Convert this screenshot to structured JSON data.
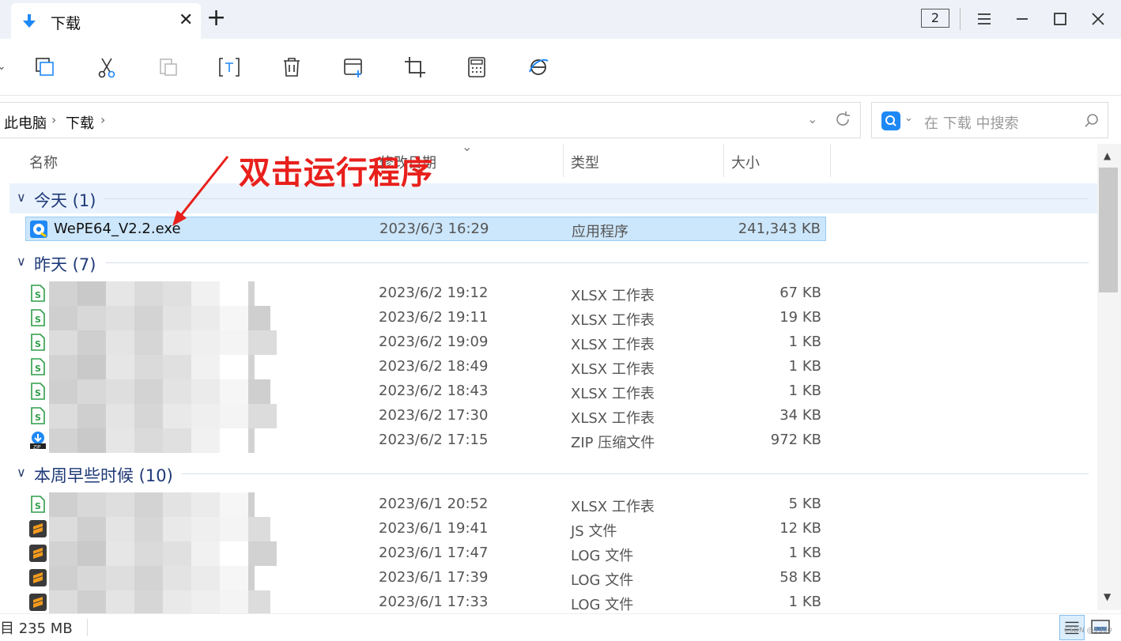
{
  "tab": {
    "title": "下载",
    "close": "✕",
    "new": "+"
  },
  "window": {
    "count": "2"
  },
  "toolbar": {
    "items": [
      "copy-icon",
      "cut-icon",
      "paste-icon",
      "rename-icon",
      "delete-icon",
      "new-folder-icon",
      "crop-icon",
      "calculator-icon",
      "browser-icon"
    ]
  },
  "address": {
    "crumbs": [
      "此电脑",
      "下载"
    ],
    "sep": "›",
    "dropdown": "⌄"
  },
  "search": {
    "placeholder": "在 下载 中搜索",
    "caret": "⌄"
  },
  "columns": {
    "name": "名称",
    "modified": "修改日期",
    "type": "类型",
    "size": "大小"
  },
  "annotation": {
    "text": "双击运行程序",
    "color": "#e8201c"
  },
  "groups": [
    {
      "label": "今天 (1)",
      "rows": [
        {
          "name": "WePE64_V2.2.exe",
          "date": "2023/6/3 16:29",
          "type": "应用程序",
          "size": "241,343 KB",
          "icon": "exe-icon",
          "selected": true
        }
      ]
    },
    {
      "label": "昨天 (7)",
      "rows": [
        {
          "name": "",
          "date": "2023/6/2 19:12",
          "type": "XLSX 工作表",
          "size": "67 KB",
          "icon": "xlsx-icon"
        },
        {
          "name": "",
          "date": "2023/6/2 19:11",
          "type": "XLSX 工作表",
          "size": "19 KB",
          "icon": "xlsx-icon"
        },
        {
          "name": "",
          "date": "2023/6/2 19:09",
          "type": "XLSX 工作表",
          "size": "1 KB",
          "icon": "xlsx-icon"
        },
        {
          "name": "",
          "date": "2023/6/2 18:49",
          "type": "XLSX 工作表",
          "size": "1 KB",
          "icon": "xlsx-icon"
        },
        {
          "name": "",
          "date": "2023/6/2 18:43",
          "type": "XLSX 工作表",
          "size": "1 KB",
          "icon": "xlsx-icon"
        },
        {
          "name": "",
          "date": "2023/6/2 17:30",
          "type": "XLSX 工作表",
          "size": "34 KB",
          "icon": "xlsx-icon"
        },
        {
          "name": "",
          "date": "2023/6/2 17:15",
          "type": "ZIP 压缩文件",
          "size": "972 KB",
          "icon": "zip-icon"
        }
      ]
    },
    {
      "label": "本周早些时候 (10)",
      "rows": [
        {
          "name": "",
          "date": "2023/6/1 20:52",
          "type": "XLSX 工作表",
          "size": "5 KB",
          "icon": "xlsx-icon"
        },
        {
          "name": "",
          "date": "2023/6/1 19:41",
          "type": "JS 文件",
          "size": "12 KB",
          "icon": "sublime-icon"
        },
        {
          "name": "",
          "date": "2023/6/1 17:47",
          "type": "LOG 文件",
          "size": "1 KB",
          "icon": "sublime-icon"
        },
        {
          "name": "",
          "date": "2023/6/1 17:39",
          "type": "LOG 文件",
          "size": "58 KB",
          "icon": "sublime-icon"
        },
        {
          "name": "",
          "date": "2023/6/1 17:33",
          "type": "LOG 文件",
          "size": "1 KB",
          "icon": "sublime-icon"
        }
      ]
    }
  ],
  "status": {
    "text": "目 235 MB",
    "watermark": "CSDN @5300"
  },
  "colors": {
    "accent": "#1e88f5",
    "selection": "#cce6fb",
    "group_text": "#1f3a78"
  }
}
